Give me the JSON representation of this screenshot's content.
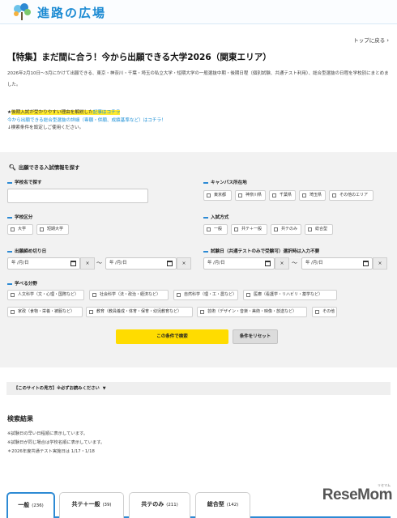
{
  "header": {
    "logo_text": "進路の広場"
  },
  "top_link": "トップに戻る",
  "page_title": "【特集】まだ間に合う！今から出願できる大学2026（関東エリア）",
  "lead": "2026年2月10日～3月にかけて出願できる、東京・神奈川・千葉・埼玉の私立大学・短期大学の一般選抜中期・後期日程（個別試験、共通テスト利用）、総合型選抜の日程を学校別にまとめました。",
  "notice": {
    "line1_prefix": "★",
    "line1_hl": "後期入試が受かりやすい理由を解説した",
    "line1_link": "記事はコチラ",
    "line2": "今から出願できる総合型選抜の詳細（専願・併願、成績基準など）はコチラ！",
    "line3": "↓検索条件を設定しご使用ください。"
  },
  "search_panel": {
    "title": "出願できる入試情報を探す",
    "school_name": {
      "label": "学校名で探す",
      "value": ""
    },
    "campus": {
      "label": "キャンパス所在地",
      "options": [
        "東京都",
        "神奈川県",
        "千葉県",
        "埼玉県",
        "その他のエリア"
      ]
    },
    "school_type": {
      "label": "学校区分",
      "options": [
        "大学",
        "短期大学"
      ]
    },
    "exam_type": {
      "label": "入試方式",
      "options": [
        "一般",
        "共テ＋一般",
        "共テのみ",
        "総合型"
      ]
    },
    "deadline": {
      "label": "出願締め切り日",
      "from_placeholder": "年 /月/日",
      "to_placeholder": "年 /月/日",
      "clear": "×",
      "tilde": "〜"
    },
    "exam_date": {
      "label": "試験日（共通テストのみで受験可）選択時は入力不要",
      "from_placeholder": "年 /月/日",
      "to_placeholder": "年 /月/日",
      "clear": "×",
      "tilde": "〜"
    },
    "field": {
      "label": "学べる分野",
      "options": [
        "人文科学（文・心理・国際など）",
        "社会科学（法・政治・経済など）",
        "自然科学（理・工・農など）",
        "医療（看護学・リハビリ・薬学など）",
        "家政（食物・栄養・被服など）",
        "教育（教員養成・体育・保育・幼児教育など）",
        "芸術（デザイン・音楽・美術・映像・放送など）",
        "その他"
      ]
    },
    "search_button": "この条件で検索",
    "reset_button": "条件をリセット"
  },
  "guide": {
    "label": "【このサイトの見方】※必ずお読みください",
    "arrow": "▼"
  },
  "results": {
    "title": "検索結果",
    "notes": [
      "※試験日の早い日程順に表示しています。",
      "※試験日が同じ場合は学校名順に表示しています。",
      "＊2026年度共通テスト実施日は 1/17・1/18"
    ],
    "tabs": [
      {
        "label": "一般",
        "count": "(236)"
      },
      {
        "label": "共テ＋一般",
        "count": "(39)"
      },
      {
        "label": "共テのみ",
        "count": "(211)"
      },
      {
        "label": "総合型",
        "count": "(142)"
      }
    ]
  },
  "watermark": {
    "text": "ReseMom",
    "small": "リセマム"
  },
  "colors": {
    "accent": "#2d8ad4",
    "search_button": "#ffdc00",
    "logo": "#1c8bd3"
  }
}
